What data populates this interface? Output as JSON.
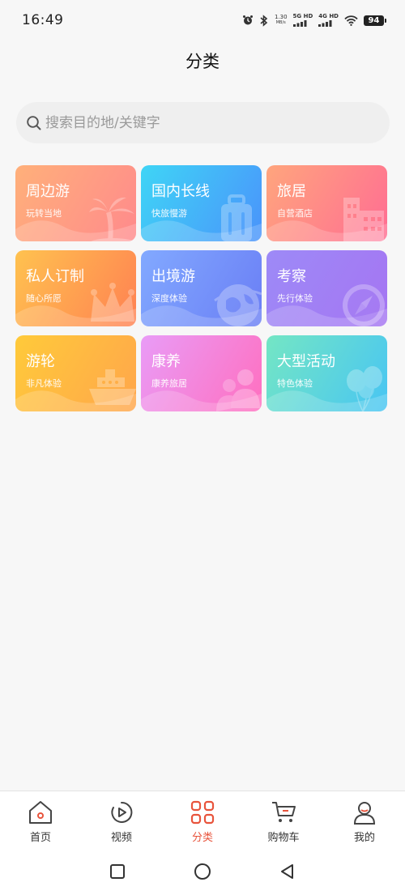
{
  "status": {
    "time": "16:49",
    "net_speed_value": "1.30",
    "net_speed_unit": "MB/s",
    "sim1_label": "5G HD",
    "sim2_label": "4G HD",
    "battery": "94",
    "icons": [
      "alarm-icon",
      "bluetooth-icon",
      "wifi-icon",
      "battery-icon"
    ]
  },
  "header": {
    "title": "分类"
  },
  "search": {
    "placeholder": "搜索目的地/关键字"
  },
  "categories": [
    {
      "title": "周边游",
      "subtitle": "玩转当地",
      "icon": "palm-tree-icon",
      "colors": [
        "#ffb07a",
        "#ff8a8c"
      ]
    },
    {
      "title": "国内长线",
      "subtitle": "快旅慢游",
      "icon": "suitcase-icon",
      "colors": [
        "#3fd5f6",
        "#4a93fb"
      ]
    },
    {
      "title": "旅居",
      "subtitle": "自营酒店",
      "icon": "building-icon",
      "colors": [
        "#ffa57d",
        "#ff6d93"
      ]
    },
    {
      "title": "私人订制",
      "subtitle": "随心所愿",
      "icon": "crown-icon",
      "colors": [
        "#ffc24f",
        "#ff8152"
      ]
    },
    {
      "title": "出境游",
      "subtitle": "深度体验",
      "icon": "globe-plane-icon",
      "colors": [
        "#82a9ff",
        "#6a7ef5"
      ]
    },
    {
      "title": "考察",
      "subtitle": "先行体验",
      "icon": "compass-icon",
      "colors": [
        "#9d8af7",
        "#a575f2"
      ]
    },
    {
      "title": "游轮",
      "subtitle": "非凡体验",
      "icon": "cruise-ship-icon",
      "colors": [
        "#ffca3a",
        "#ffa64b"
      ]
    },
    {
      "title": "康养",
      "subtitle": "康养旅居",
      "icon": "people-icon",
      "colors": [
        "#e99cf7",
        "#ff6fbf"
      ]
    },
    {
      "title": "大型活动",
      "subtitle": "特色体验",
      "icon": "balloons-icon",
      "colors": [
        "#74e6c4",
        "#48c5f3"
      ]
    }
  ],
  "tabbar": {
    "items": [
      {
        "label": "首页",
        "icon": "home-icon"
      },
      {
        "label": "视频",
        "icon": "play-icon"
      },
      {
        "label": "分类",
        "icon": "category-grid-icon",
        "active": true
      },
      {
        "label": "购物车",
        "icon": "cart-icon"
      },
      {
        "label": "我的",
        "icon": "user-icon"
      }
    ]
  },
  "system_nav": [
    "recent-apps-icon",
    "home-circle-icon",
    "back-icon"
  ],
  "colors": {
    "accent": "#e8543c",
    "background": "#f7f7f7"
  }
}
